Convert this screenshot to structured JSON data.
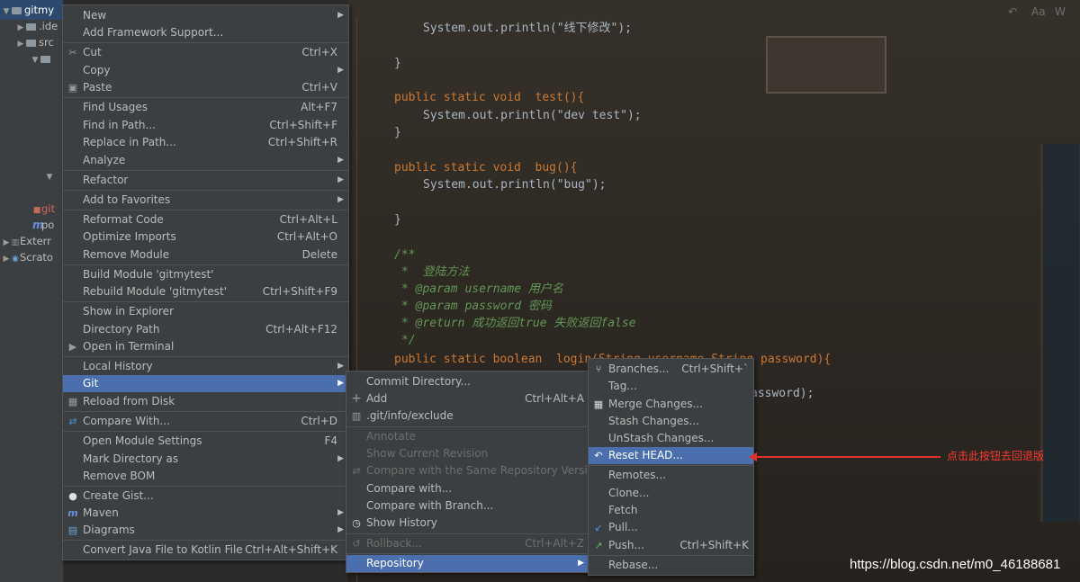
{
  "project_tree": {
    "root": "gitmy",
    "items": [
      ".ide",
      "src",
      "git",
      "po",
      "Exterr",
      "Scrato"
    ]
  },
  "code_lines": [
    "System.out.println(\"线下修改\");",
    "}",
    "public static void  test(){",
    "System.out.println(\"dev test\");",
    "}",
    "public static void  bug(){",
    "System.out.println(\"bug\");",
    "}",
    "/**",
    "*  登陆方法",
    "* @param username 用户名",
    "* @param password 密码",
    "* @return 成功返回true 失败返回false",
    "*/",
    "public static boolean  login(String username,String password){",
    "assword);"
  ],
  "context_menu": [
    {
      "label": "New",
      "arrow": true
    },
    {
      "label": "Add Framework Support..."
    },
    {
      "label": "Cut",
      "shortcut": "Ctrl+X",
      "icon": "scissors-icon"
    },
    {
      "label": "Copy",
      "arrow": true
    },
    {
      "label": "Paste",
      "shortcut": "Ctrl+V",
      "icon": "clipboard-icon"
    },
    {
      "label": "Find Usages",
      "shortcut": "Alt+F7"
    },
    {
      "label": "Find in Path...",
      "shortcut": "Ctrl+Shift+F"
    },
    {
      "label": "Replace in Path...",
      "shortcut": "Ctrl+Shift+R"
    },
    {
      "label": "Analyze",
      "arrow": true
    },
    {
      "label": "Refactor",
      "arrow": true
    },
    {
      "label": "Add to Favorites",
      "arrow": true
    },
    {
      "label": "Reformat Code",
      "shortcut": "Ctrl+Alt+L"
    },
    {
      "label": "Optimize Imports",
      "shortcut": "Ctrl+Alt+O"
    },
    {
      "label": "Remove Module",
      "shortcut": "Delete"
    },
    {
      "label": "Build Module 'gitmytest'"
    },
    {
      "label": "Rebuild Module 'gitmytest'",
      "shortcut": "Ctrl+Shift+F9"
    },
    {
      "label": "Show in Explorer"
    },
    {
      "label": "Directory Path",
      "shortcut": "Ctrl+Alt+F12"
    },
    {
      "label": "Open in Terminal",
      "icon": "terminal-icon"
    },
    {
      "label": "Local History",
      "arrow": true
    },
    {
      "label": "Git",
      "arrow": true,
      "selected": true
    },
    {
      "label": "Reload from Disk",
      "icon": "reload-icon"
    },
    {
      "label": "Compare With...",
      "shortcut": "Ctrl+D",
      "icon": "compare-icon"
    },
    {
      "label": "Open Module Settings",
      "shortcut": "F4"
    },
    {
      "label": "Mark Directory as",
      "arrow": true
    },
    {
      "label": "Remove BOM"
    },
    {
      "label": "Create Gist...",
      "icon": "github-icon"
    },
    {
      "label": "Maven",
      "arrow": true,
      "icon": "maven-icon"
    },
    {
      "label": "Diagrams",
      "arrow": true,
      "icon": "diagram-icon"
    },
    {
      "label": "Convert Java File to Kotlin File",
      "shortcut": "Ctrl+Alt+Shift+K"
    }
  ],
  "git_menu": [
    {
      "label": "Commit Directory..."
    },
    {
      "label": "Add",
      "shortcut": "Ctrl+Alt+A",
      "icon": "plus-icon"
    },
    {
      "label": ".git/info/exclude",
      "icon": "file-icon"
    },
    {
      "label": "Annotate",
      "disabled": true
    },
    {
      "label": "Show Current Revision",
      "disabled": true
    },
    {
      "label": "Compare with the Same Repository Version",
      "disabled": true,
      "icon": "compare-icon"
    },
    {
      "label": "Compare with..."
    },
    {
      "label": "Compare with Branch..."
    },
    {
      "label": "Show History",
      "icon": "clock-icon"
    },
    {
      "label": "Rollback...",
      "shortcut": "Ctrl+Alt+Z",
      "disabled": true,
      "icon": "rollback-icon"
    },
    {
      "label": "Repository",
      "arrow": true,
      "selected": true
    }
  ],
  "repository_menu": [
    {
      "label": "Branches...",
      "shortcut": "Ctrl+Shift+`",
      "icon": "branch-icon"
    },
    {
      "label": "Tag..."
    },
    {
      "label": "Merge Changes...",
      "icon": "merge-icon"
    },
    {
      "label": "Stash Changes..."
    },
    {
      "label": "UnStash Changes..."
    },
    {
      "label": "Reset HEAD...",
      "selected": true,
      "icon": "undo-icon"
    },
    {
      "label": "Remotes..."
    },
    {
      "label": "Clone..."
    },
    {
      "label": "Fetch"
    },
    {
      "label": "Pull...",
      "icon": "pull-icon"
    },
    {
      "label": "Push...",
      "shortcut": "Ctrl+Shift+K",
      "icon": "push-icon"
    },
    {
      "label": "Rebase..."
    }
  ],
  "annotation": "点击此按钮去回退版",
  "watermark": "https://blog.csdn.net/m0_46188681",
  "colors": {
    "selection": "#4b6eaf",
    "menu_bg": "#3c3f41",
    "annotation": "#e0302c"
  }
}
